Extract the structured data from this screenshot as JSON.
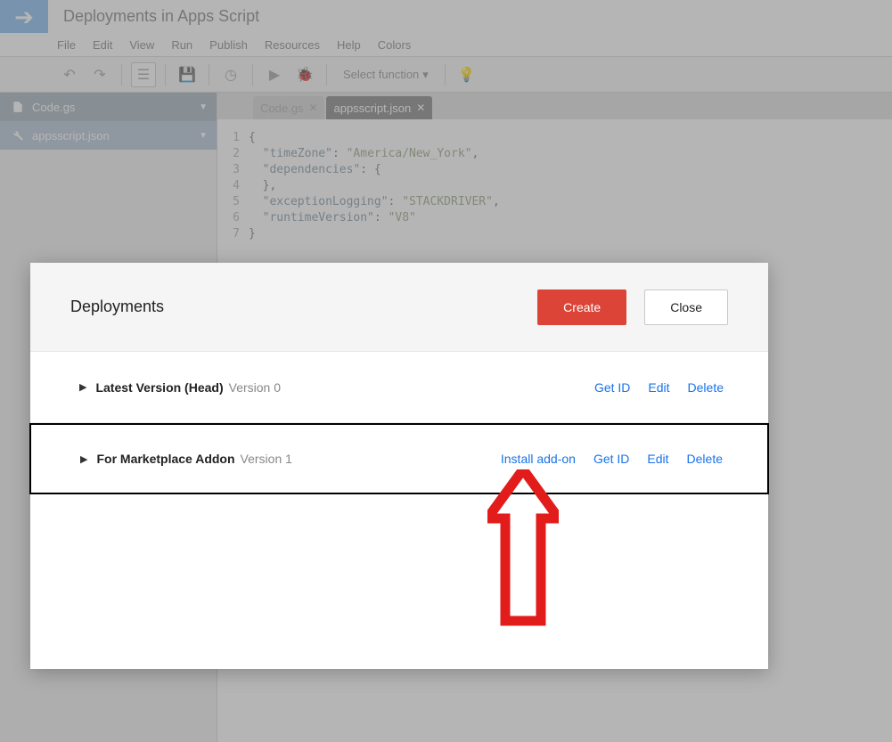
{
  "header": {
    "title": "Deployments in Apps Script"
  },
  "menu": {
    "file": "File",
    "edit": "Edit",
    "view": "View",
    "run": "Run",
    "publish": "Publish",
    "resources": "Resources",
    "help": "Help",
    "colors": "Colors"
  },
  "toolbar": {
    "select_function": "Select function"
  },
  "sidebar": {
    "items": [
      {
        "label": "Code.gs"
      },
      {
        "label": "appsscript.json"
      }
    ]
  },
  "tabs": {
    "t0": {
      "label": "Code.gs"
    },
    "t1": {
      "label": "appsscript.json"
    }
  },
  "code": {
    "l1_a": "{",
    "l2_key": "\"timeZone\"",
    "l2_colon": ": ",
    "l2_val": "\"America/New_York\"",
    "l2_end": ",",
    "l3_key": "\"dependencies\"",
    "l3_colon": ": ",
    "l3_val": "{",
    "l4_a": "  },",
    "l5_key": "\"exceptionLogging\"",
    "l5_colon": ": ",
    "l5_val": "\"STACKDRIVER\"",
    "l5_end": ",",
    "l6_key": "\"runtimeVersion\"",
    "l6_colon": ": ",
    "l6_val": "\"V8\"",
    "l7_a": "}"
  },
  "dialog": {
    "title": "Deployments",
    "create": "Create",
    "close": "Close",
    "rows": [
      {
        "name": "Latest Version (Head)",
        "version": "Version 0",
        "actions": {
          "get_id": "Get ID",
          "edit": "Edit",
          "delete": "Delete"
        }
      },
      {
        "name": "For Marketplace Addon",
        "version": "Version 1",
        "actions": {
          "install": "Install add-on",
          "get_id": "Get ID",
          "edit": "Edit",
          "delete": "Delete"
        }
      }
    ]
  },
  "gutter": {
    "n1": "1",
    "n2": "2",
    "n3": "3",
    "n4": "4",
    "n5": "5",
    "n6": "6",
    "n7": "7"
  }
}
